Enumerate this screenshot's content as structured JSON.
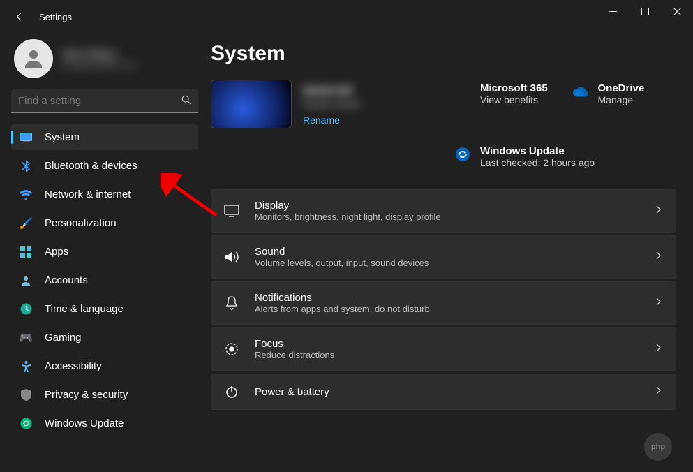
{
  "app": {
    "title": "Settings"
  },
  "profile": {
    "name": "User Name",
    "email": "user@example.com"
  },
  "search": {
    "placeholder": "Find a setting"
  },
  "sidebar": {
    "items": [
      {
        "label": "System"
      },
      {
        "label": "Bluetooth & devices"
      },
      {
        "label": "Network & internet"
      },
      {
        "label": "Personalization"
      },
      {
        "label": "Apps"
      },
      {
        "label": "Accounts"
      },
      {
        "label": "Time & language"
      },
      {
        "label": "Gaming"
      },
      {
        "label": "Accessibility"
      },
      {
        "label": "Privacy & security"
      },
      {
        "label": "Windows Update"
      }
    ]
  },
  "page": {
    "title": "System",
    "device": {
      "name": "DESKTOP",
      "model": "System Model",
      "rename": "Rename"
    },
    "tiles": {
      "m365": {
        "title": "Microsoft 365",
        "sub": "View benefits"
      },
      "onedrive": {
        "title": "OneDrive",
        "sub": "Manage"
      },
      "update": {
        "title": "Windows Update",
        "sub": "Last checked: 2 hours ago"
      }
    },
    "settings": [
      {
        "title": "Display",
        "sub": "Monitors, brightness, night light, display profile"
      },
      {
        "title": "Sound",
        "sub": "Volume levels, output, input, sound devices"
      },
      {
        "title": "Notifications",
        "sub": "Alerts from apps and system, do not disturb"
      },
      {
        "title": "Focus",
        "sub": "Reduce distractions"
      },
      {
        "title": "Power & battery",
        "sub": ""
      }
    ]
  }
}
